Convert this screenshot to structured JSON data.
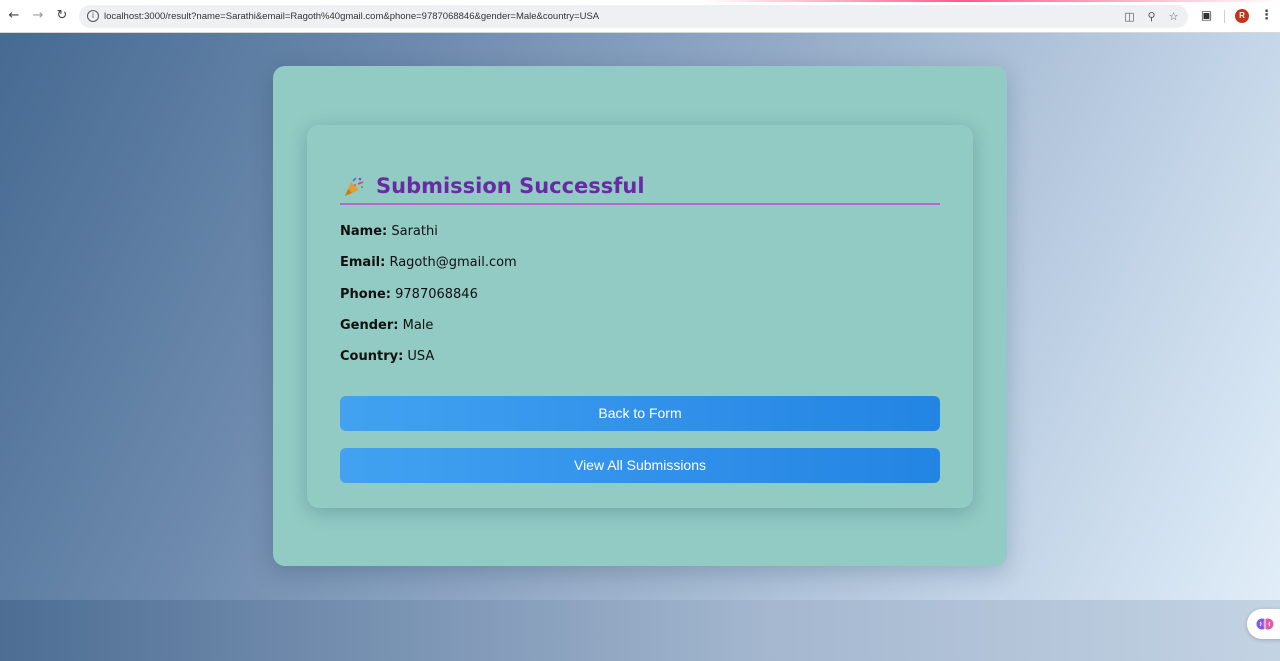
{
  "browser": {
    "url": "localhost:3000/result?name=Sarathi&email=Ragoth%40gmail.com&phone=9787068846&gender=Male&country=USA",
    "profile_initial": "R",
    "accent_color": "#ff5a8a",
    "profile_color": "#c2361e",
    "icons": {
      "back": "back-arrow-icon",
      "forward": "forward-arrow-icon",
      "reload": "reload-icon",
      "site_info": "site-info-icon",
      "install": "install-app-icon",
      "zoom": "zoom-icon",
      "bookmark": "star-icon",
      "extensions": "extensions-icon",
      "menu": "kebab-menu-icon"
    }
  },
  "result": {
    "title": "Submission Successful",
    "icon": "party-popper-icon",
    "title_color": "#6a2aa6",
    "fields": [
      {
        "label": "Name:",
        "value": "Sarathi"
      },
      {
        "label": "Email:",
        "value": "Ragoth@gmail.com"
      },
      {
        "label": "Phone:",
        "value": "9787068846"
      },
      {
        "label": "Gender:",
        "value": "Male"
      },
      {
        "label": "Country:",
        "value": "USA"
      }
    ],
    "buttons": {
      "back_to_form": "Back to Form",
      "view_all": "View All Submissions"
    },
    "button_color": "#2f8fe9",
    "card_color": "#92cac4"
  },
  "floating_widget": {
    "icon": "ai-brain-icon"
  }
}
